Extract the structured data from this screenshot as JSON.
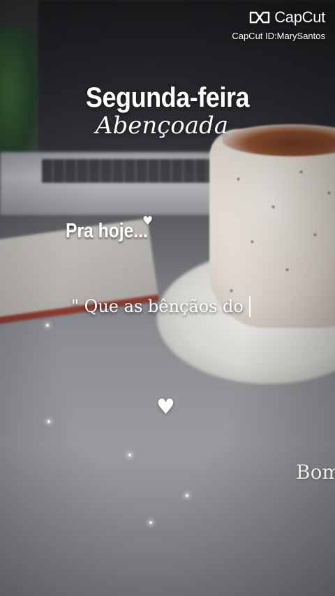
{
  "watermark": {
    "brand": "CapCut",
    "brand_icon": "capcut-logo-icon",
    "id_text": "CapCut ID:MarySantos"
  },
  "overlay": {
    "title": "Segunda-feira",
    "subtitle": "Abençoada",
    "intro": "Pra hoje...",
    "intro_heart": "heart-icon",
    "quote": "\" Que as bênçãos do",
    "center_heart": "heart-icon",
    "partial_word": "Bom"
  },
  "colors": {
    "text": "#ffffff",
    "background": "#6b6b6f"
  }
}
